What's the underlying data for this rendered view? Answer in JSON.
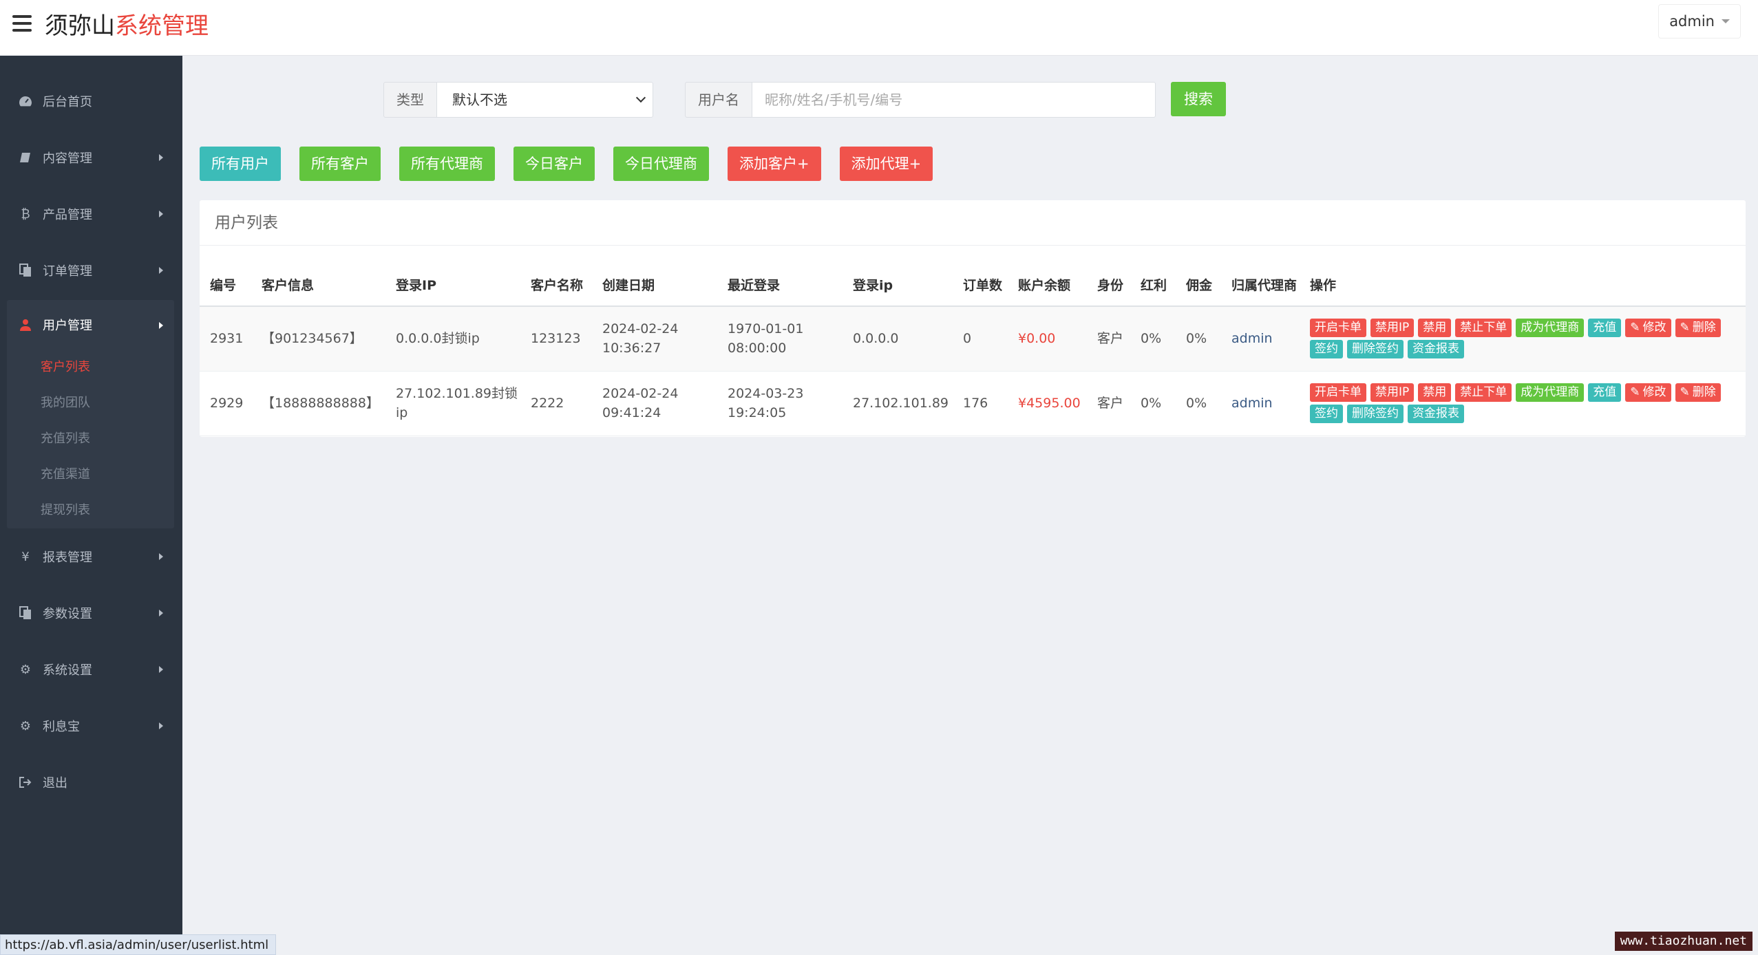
{
  "header": {
    "brand_part1": "须弥山",
    "brand_part2": "系统管理",
    "user": "admin"
  },
  "sidebar": {
    "items": [
      {
        "label": "后台首页",
        "icon": "dashboard-icon"
      },
      {
        "label": "内容管理",
        "icon": "book-icon"
      },
      {
        "label": "产品管理",
        "icon": "bitcoin-icon"
      },
      {
        "label": "订单管理",
        "icon": "copy-icon"
      },
      {
        "label": "用户管理",
        "icon": "user-icon"
      },
      {
        "label": "报表管理",
        "icon": "yen-icon"
      },
      {
        "label": "参数设置",
        "icon": "copy-icon"
      },
      {
        "label": "系统设置",
        "icon": "gears-icon"
      },
      {
        "label": "利息宝",
        "icon": "gears-icon"
      },
      {
        "label": "退出",
        "icon": "sign-out-icon"
      }
    ],
    "submenu": [
      "客户列表",
      "我的团队",
      "充值列表",
      "充值渠道",
      "提现列表"
    ]
  },
  "search": {
    "type_label": "类型",
    "type_value": "默认不选",
    "username_label": "用户名",
    "username_placeholder": "昵称/姓名/手机号/编号",
    "search_button": "搜索"
  },
  "filters": [
    "所有用户",
    "所有客户",
    "所有代理商",
    "今日客户",
    "今日代理商",
    "添加客户+",
    "添加代理+"
  ],
  "panel": {
    "title": "用户列表",
    "columns": [
      "编号",
      "客户信息",
      "登录IP",
      "客户名称",
      "创建日期",
      "最近登录",
      "登录ip",
      "订单数",
      "账户余额",
      "身份",
      "红利",
      "佣金",
      "归属代理商",
      "操作"
    ],
    "rows": [
      {
        "id": "2931",
        "info": "【901234567】",
        "login_ip": "0.0.0.0封锁ip",
        "name": "123123",
        "created": "2024-02-24 10:36:27",
        "last_login": "1970-01-01 08:00:00",
        "ip": "0.0.0.0",
        "orders": "0",
        "balance": "¥0.00",
        "role": "客户",
        "bonus": "0%",
        "commission": "0%",
        "agent": "admin"
      },
      {
        "id": "2929",
        "info": "【18888888888】",
        "login_ip": "27.102.101.89封锁ip",
        "name": "2222",
        "created": "2024-02-24 09:41:24",
        "last_login": "2024-03-23 19:24:05",
        "ip": "27.102.101.89",
        "orders": "176",
        "balance": "¥4595.00",
        "role": "客户",
        "bonus": "0%",
        "commission": "0%",
        "agent": "admin"
      }
    ],
    "ops": {
      "open_card": "开启卡单",
      "ban_ip": "禁用IP",
      "ban": "禁用",
      "ban_order": "禁止下单",
      "make_agent": "成为代理商",
      "recharge": "充值",
      "edit": "修改",
      "delete": "删除",
      "sign": "签约",
      "delete_sign": "删除签约",
      "fund_report": "资金报表"
    }
  },
  "status_url": "https://ab.vfl.asia/admin/user/userlist.html",
  "watermark": "www.tiaozhuan.net",
  "colors": {
    "sidebar": "#2b3440",
    "accent": "#e9463d",
    "green": "#62c53e",
    "cyan": "#3cbcb8",
    "red": "#f0534c"
  }
}
